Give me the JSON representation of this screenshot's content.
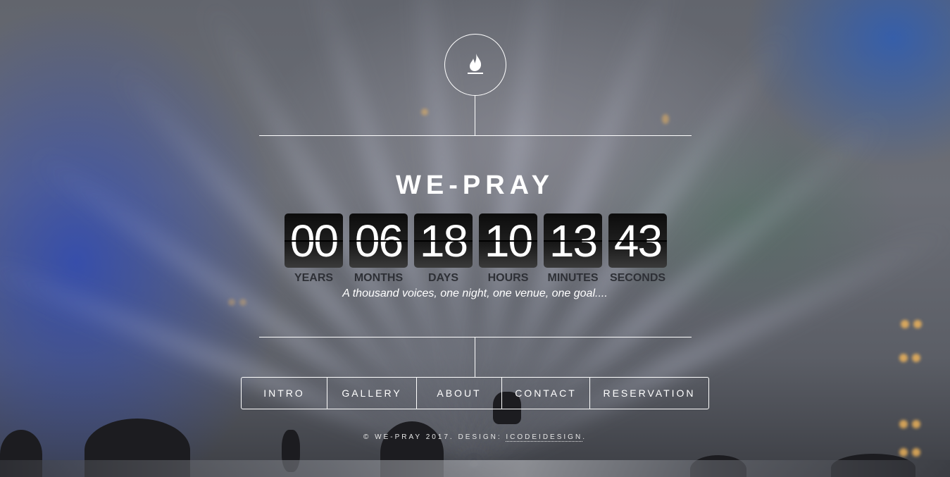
{
  "site": {
    "logo_icon": "flame-icon",
    "title": "WE-PRAY"
  },
  "countdown": {
    "units": [
      {
        "value": "00",
        "label": "YEARS"
      },
      {
        "value": "06",
        "label": "MONTHS"
      },
      {
        "value": "18",
        "label": "DAYS"
      },
      {
        "value": "10",
        "label": "HOURS"
      },
      {
        "value": "13",
        "label": "MINUTES"
      },
      {
        "value": "43",
        "label": "SECONDS"
      }
    ]
  },
  "tagline": "A thousand voices, one night, one venue, one goal....",
  "nav": {
    "items": [
      {
        "label": "INTRO"
      },
      {
        "label": "GALLERY"
      },
      {
        "label": "ABOUT"
      },
      {
        "label": "CONTACT"
      },
      {
        "label": "RESERVATION"
      }
    ]
  },
  "footer": {
    "text": "© WE-PRAY 2017. DESIGN: ",
    "link": "ICODEIDESIGN",
    "suffix": "."
  },
  "colors": {
    "text": "#ffffff",
    "counter_bg": "#111111",
    "label_color": "#2e3036"
  }
}
